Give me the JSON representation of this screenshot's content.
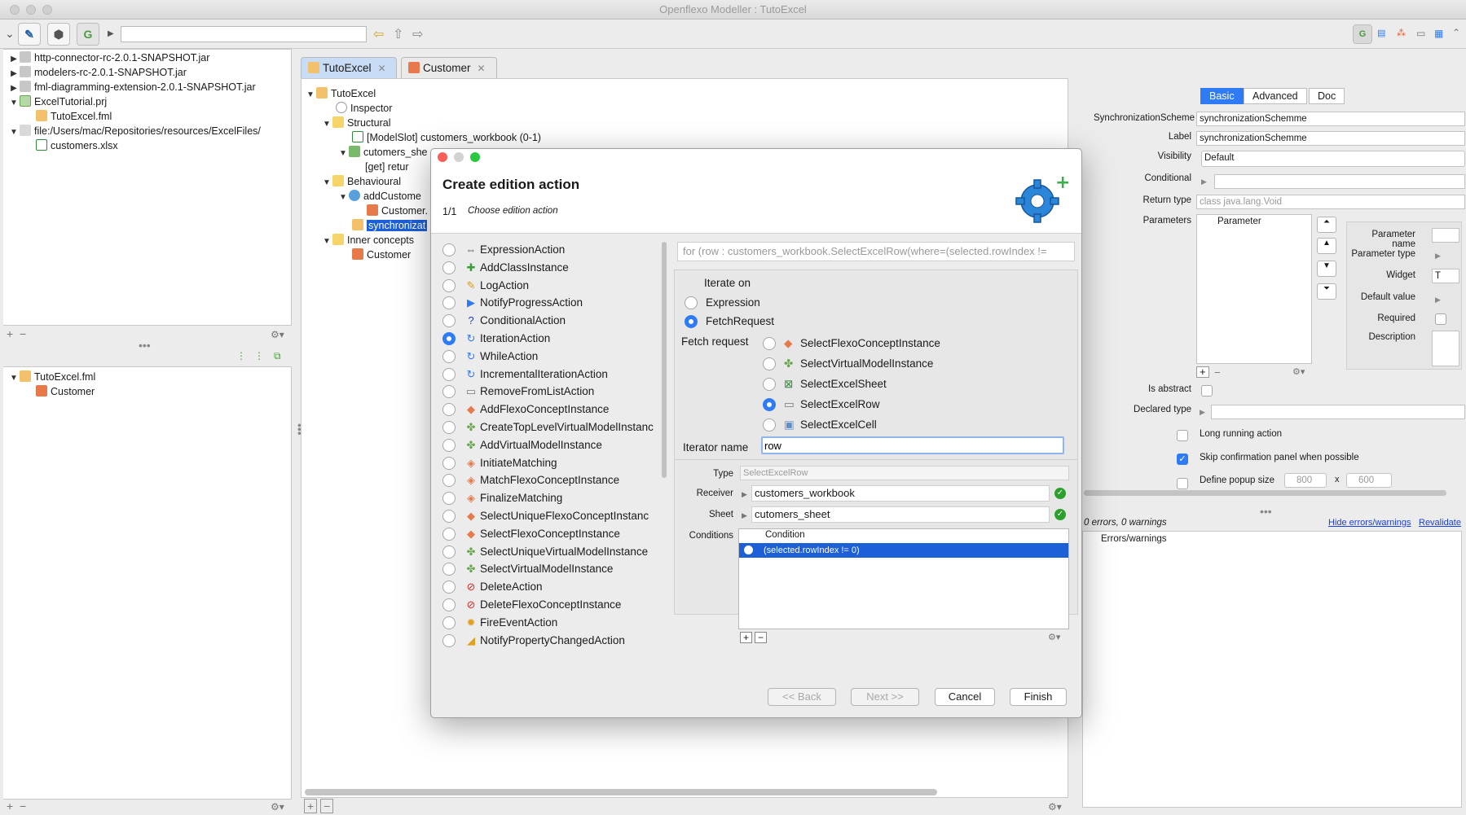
{
  "window": {
    "title": "Openflexo Modeller : TutoExcel"
  },
  "toolbar": {
    "search_value": ""
  },
  "project_tree": [
    {
      "label": "http-connector-rc-2.0.1-SNAPSHOT.jar"
    },
    {
      "label": "modelers-rc-2.0.1-SNAPSHOT.jar"
    },
    {
      "label": "fml-diagramming-extension-2.0.1-SNAPSHOT.jar"
    },
    {
      "label": "ExcelTutorial.prj"
    },
    {
      "label": "TutoExcel.fml"
    },
    {
      "label": "file:/Users/mac/Repositories/resources/ExcelFiles/"
    },
    {
      "label": "customers.xlsx"
    }
  ],
  "fml_tree": [
    {
      "label": "TutoExcel.fml"
    },
    {
      "label": "Customer"
    }
  ],
  "tabs": [
    {
      "label": "TutoExcel"
    },
    {
      "label": "Customer"
    }
  ],
  "concept_tree": [
    {
      "label": "TutoExcel"
    },
    {
      "label": "Inspector"
    },
    {
      "label": "Structural"
    },
    {
      "label": "[ModelSlot] customers_workbook (0-1)"
    },
    {
      "label": "cutomers_she"
    },
    {
      "label": "[get] retur"
    },
    {
      "label": "Behavioural"
    },
    {
      "label": "addCustome"
    },
    {
      "label": "Customer."
    },
    {
      "label": "synchronizat"
    },
    {
      "label": "Inner concepts"
    },
    {
      "label": "Customer"
    }
  ],
  "inspector": {
    "tabs": [
      "Basic",
      "Advanced",
      "Doc"
    ],
    "labels": {
      "scheme": "SynchronizationScheme",
      "label": "Label",
      "visibility": "Visibility",
      "conditional": "Conditional",
      "return_type": "Return type",
      "parameters": "Parameters",
      "is_abstract": "Is abstract",
      "declared_type": "Declared type",
      "long_running": "Long running action",
      "skip_confirm": "Skip confirmation panel when possible",
      "popup_size": "Define popup size",
      "param_name": "Parameter name",
      "param_type": "Parameter type",
      "widget": "Widget",
      "default_value": "Default value",
      "required": "Required",
      "description": "Description"
    },
    "values": {
      "scheme": "synchronizationSchemme",
      "label": "synchronizationSchemme",
      "visibility": "Default",
      "return_type": "class java.lang.Void",
      "parameter_header": "Parameter",
      "widget": "T",
      "popup_w": "800",
      "popup_x": "x",
      "popup_h": "600"
    },
    "errors": {
      "summary": "0 errors, 0 warnings",
      "hide_link": "Hide errors/warnings",
      "revalidate_link": "Revalidate",
      "header": "Errors/warnings"
    }
  },
  "dialog": {
    "title": "Create edition action",
    "step": "1/1",
    "subtitle": "Choose edition action",
    "actions": [
      {
        "label": "ExpressionAction",
        "icon": "expression-icon",
        "selected": false
      },
      {
        "label": "AddClassInstance",
        "icon": "add-class-icon",
        "selected": false
      },
      {
        "label": "LogAction",
        "icon": "log-icon",
        "selected": false
      },
      {
        "label": "NotifyProgressAction",
        "icon": "progress-icon",
        "selected": false
      },
      {
        "label": "ConditionalAction",
        "icon": "question-icon",
        "selected": false
      },
      {
        "label": "IterationAction",
        "icon": "loop-icon",
        "selected": true
      },
      {
        "label": "WhileAction",
        "icon": "loop-icon",
        "selected": false
      },
      {
        "label": "IncrementalIterationAction",
        "icon": "loop-icon",
        "selected": false
      },
      {
        "label": "RemoveFromListAction",
        "icon": "remove-icon",
        "selected": false
      },
      {
        "label": "AddFlexoConceptInstance",
        "icon": "concept-icon",
        "selected": false
      },
      {
        "label": "CreateTopLevelVirtualModelInstanc",
        "icon": "virtual-model-icon",
        "selected": false
      },
      {
        "label": "AddVirtualModelInstance",
        "icon": "virtual-model-icon",
        "selected": false
      },
      {
        "label": "InitiateMatching",
        "icon": "matching-icon",
        "selected": false
      },
      {
        "label": "MatchFlexoConceptInstance",
        "icon": "matching-icon",
        "selected": false
      },
      {
        "label": "FinalizeMatching",
        "icon": "matching-icon",
        "selected": false
      },
      {
        "label": "SelectUniqueFlexoConceptInstanc",
        "icon": "select-icon",
        "selected": false
      },
      {
        "label": "SelectFlexoConceptInstance",
        "icon": "select-icon",
        "selected": false
      },
      {
        "label": "SelectUniqueVirtualModelInstance",
        "icon": "virtual-model-icon",
        "selected": false
      },
      {
        "label": "SelectVirtualModelInstance",
        "icon": "virtual-model-icon",
        "selected": false
      },
      {
        "label": "DeleteAction",
        "icon": "delete-icon",
        "selected": false
      },
      {
        "label": "DeleteFlexoConceptInstance",
        "icon": "delete-icon",
        "selected": false
      },
      {
        "label": "FireEventAction",
        "icon": "fire-event-icon",
        "selected": false
      },
      {
        "label": "NotifyPropertyChangedAction",
        "icon": "notify-icon",
        "selected": false
      }
    ],
    "preview": "for (row : customers_workbook.SelectExcelRow(where=(selected.rowIndex !=",
    "iterate_on_label": "Iterate on",
    "iterate_options": [
      {
        "label": "Expression",
        "selected": false
      },
      {
        "label": "FetchRequest",
        "selected": true
      }
    ],
    "fetch_request_label": "Fetch request",
    "fetch_options": [
      {
        "label": "SelectFlexoConceptInstance",
        "selected": false
      },
      {
        "label": "SelectVirtualModelInstance",
        "selected": false
      },
      {
        "label": "SelectExcelSheet",
        "selected": false
      },
      {
        "label": "SelectExcelRow",
        "selected": true
      },
      {
        "label": "SelectExcelCell",
        "selected": false
      }
    ],
    "iterator_name_label": "Iterator name",
    "iterator_name_value": "row",
    "type_label": "Type",
    "type_value": "SelectExcelRow",
    "receiver_label": "Receiver",
    "receiver_value": "customers_workbook",
    "sheet_label": "Sheet",
    "sheet_value": "cutomers_sheet",
    "conditions_label": "Conditions",
    "condition_header": "Condition",
    "condition_row": "(selected.rowIndex != 0)",
    "buttons": {
      "back": "<< Back",
      "next": "Next >>",
      "cancel": "Cancel",
      "finish": "Finish"
    }
  }
}
